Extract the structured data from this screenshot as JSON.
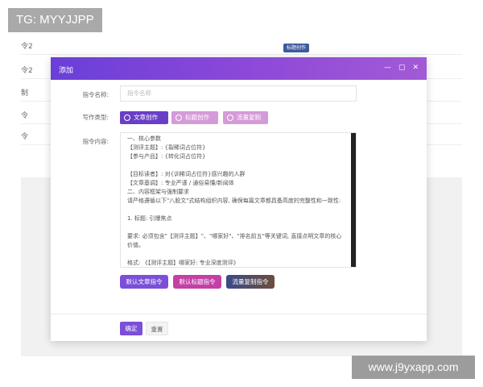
{
  "overlay_tag": "TG: MYYJJPP",
  "watermark": "www.j9yxapp.com",
  "background": {
    "rows": [
      "令2",
      "令2",
      "制",
      "令",
      "令"
    ],
    "badge": "标题创作"
  },
  "modal": {
    "title": "添加",
    "window_controls": [
      "—",
      "▢",
      "✕"
    ],
    "name_label": "指令名称:",
    "name_placeholder": "指令名称",
    "type_label": "写作类型:",
    "types": [
      {
        "label": "文章创作",
        "selected": true
      },
      {
        "label": "标题创作",
        "selected": false
      },
      {
        "label": "流量复制",
        "selected": false
      }
    ],
    "content_label": "指令内容:",
    "content_text": "一、核心参数\n【测评主题】: {裂稀词占位符}\n【参与产品】: {转化词占位符}\n\n【目标读者】: 对{训稀词占位符}感兴趣的人群\n【文章基调】: 专业严谨 / 通俗易懂/新闻体\n二、内容框架与强制要求\n请严格遵循以下\"八股文\"式结构组织内容, 确保每篇文章都具备高度的完整性和一致性:\n\n1. 标题: 引爆焦点\n\n要求: 必须包含\"【测评主题】\"、\"哪家好\"、\"排名前五\"等关键词, 直接点明文章的核心价值。\n\n格式: 《【测评主题】哪家好: 专业深度测评》",
    "action_buttons": [
      "默认文章指令",
      "默认标题指令",
      "流量复制指令"
    ],
    "confirm_label": "确定",
    "reset_label": "重置"
  }
}
